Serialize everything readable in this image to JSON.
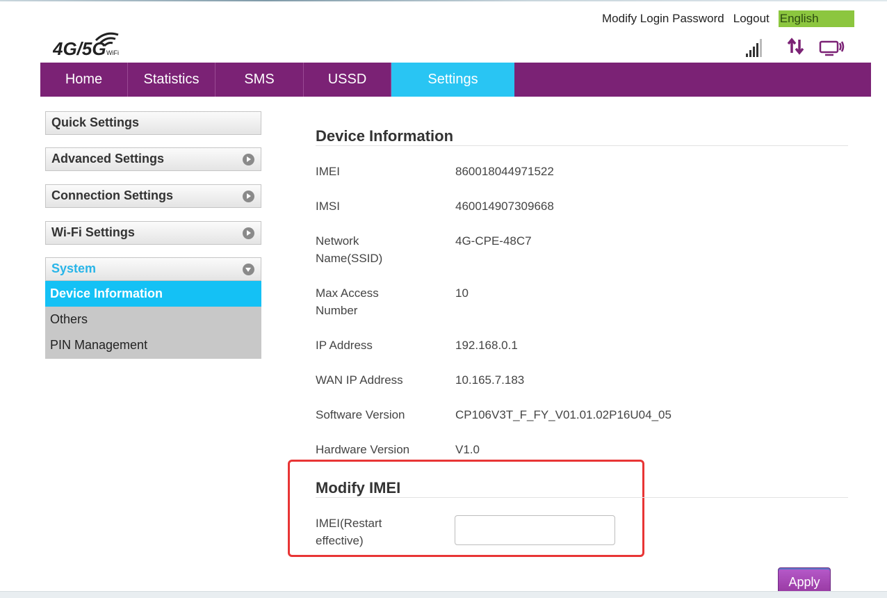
{
  "header": {
    "modify_password": "Modify Login Password",
    "logout": "Logout",
    "language": "English",
    "logo_text": "4G/5G",
    "logo_sub": "WiFi"
  },
  "status_icons": [
    "signal-strength-icon",
    "data-transfer-icon",
    "connected-devices-icon"
  ],
  "nav": {
    "items": [
      {
        "label": "Home"
      },
      {
        "label": "Statistics"
      },
      {
        "label": "SMS"
      },
      {
        "label": "USSD"
      },
      {
        "label": "Settings",
        "active": true
      }
    ]
  },
  "sidebar": {
    "quick": "Quick Settings",
    "advanced": "Advanced Settings",
    "connection": "Connection Settings",
    "wifi": "Wi-Fi Settings",
    "system": "System",
    "system_items": [
      {
        "label": "Device Information",
        "active": true
      },
      {
        "label": "Others"
      },
      {
        "label": "PIN Management"
      }
    ]
  },
  "device_info": {
    "title": "Device Information",
    "rows": [
      {
        "label": "IMEI",
        "value": "860018044971522"
      },
      {
        "label": "IMSI",
        "value": "460014907309668"
      },
      {
        "label": "Network Name(SSID)",
        "value": "4G-CPE-48C7"
      },
      {
        "label": "Max Access Number",
        "value": "10"
      },
      {
        "label": "IP Address",
        "value": "192.168.0.1"
      },
      {
        "label": "WAN IP Address",
        "value": "10.165.7.183"
      },
      {
        "label": "Software Version",
        "value": "CP106V3T_F_FY_V01.01.02P16U04_05"
      },
      {
        "label": "Hardware Version",
        "value": "V1.0"
      }
    ]
  },
  "modify_imei": {
    "title": "Modify IMEI",
    "field_label": "IMEI(Restart effective)",
    "value": ""
  },
  "apply_label": "Apply",
  "colors": {
    "nav_bg": "#7b2275",
    "nav_active": "#29c5f3",
    "lang_bg": "#8cc63f",
    "sidebar_active": "#14c1f5",
    "highlight": "#e83535",
    "apply_btn": "#a646b5"
  }
}
